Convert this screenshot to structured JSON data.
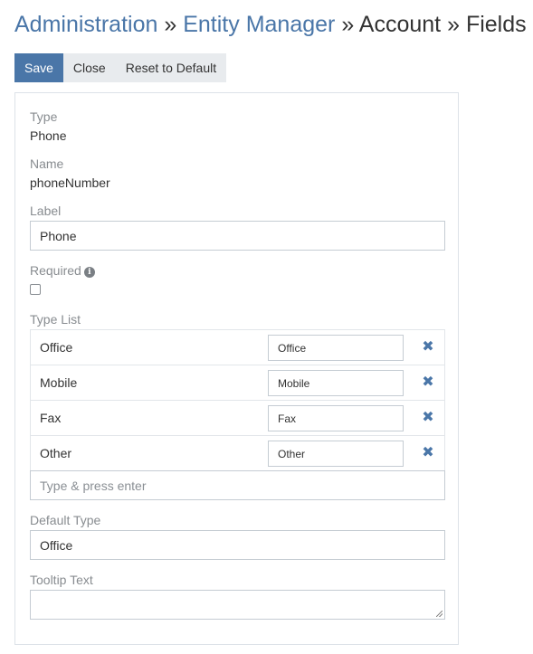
{
  "breadcrumb": {
    "items": [
      {
        "label": "Administration",
        "link": true
      },
      {
        "label": "Entity Manager",
        "link": true
      },
      {
        "label": "Account",
        "link": false
      },
      {
        "label": "Fields",
        "link": false
      }
    ],
    "separator": "»"
  },
  "toolbar": {
    "save_label": "Save",
    "close_label": "Close",
    "reset_label": "Reset to Default"
  },
  "form": {
    "type": {
      "label": "Type",
      "value": "Phone"
    },
    "name": {
      "label": "Name",
      "value": "phoneNumber"
    },
    "label_field": {
      "label": "Label",
      "value": "Phone"
    },
    "required": {
      "label": "Required",
      "checked": false,
      "info_icon": "info-icon"
    },
    "type_list": {
      "label": "Type List",
      "items": [
        {
          "name": "Office",
          "translation": "Office"
        },
        {
          "name": "Mobile",
          "translation": "Mobile"
        },
        {
          "name": "Fax",
          "translation": "Fax"
        },
        {
          "name": "Other",
          "translation": "Other"
        }
      ],
      "add_placeholder": "Type & press enter",
      "remove_icon": "close-icon"
    },
    "default_type": {
      "label": "Default Type",
      "value": "Office"
    },
    "tooltip_text": {
      "label": "Tooltip Text",
      "value": ""
    }
  },
  "colors": {
    "accent": "#4a76a8",
    "button_default_bg": "#e8ebee",
    "label_gray": "#888c90"
  }
}
